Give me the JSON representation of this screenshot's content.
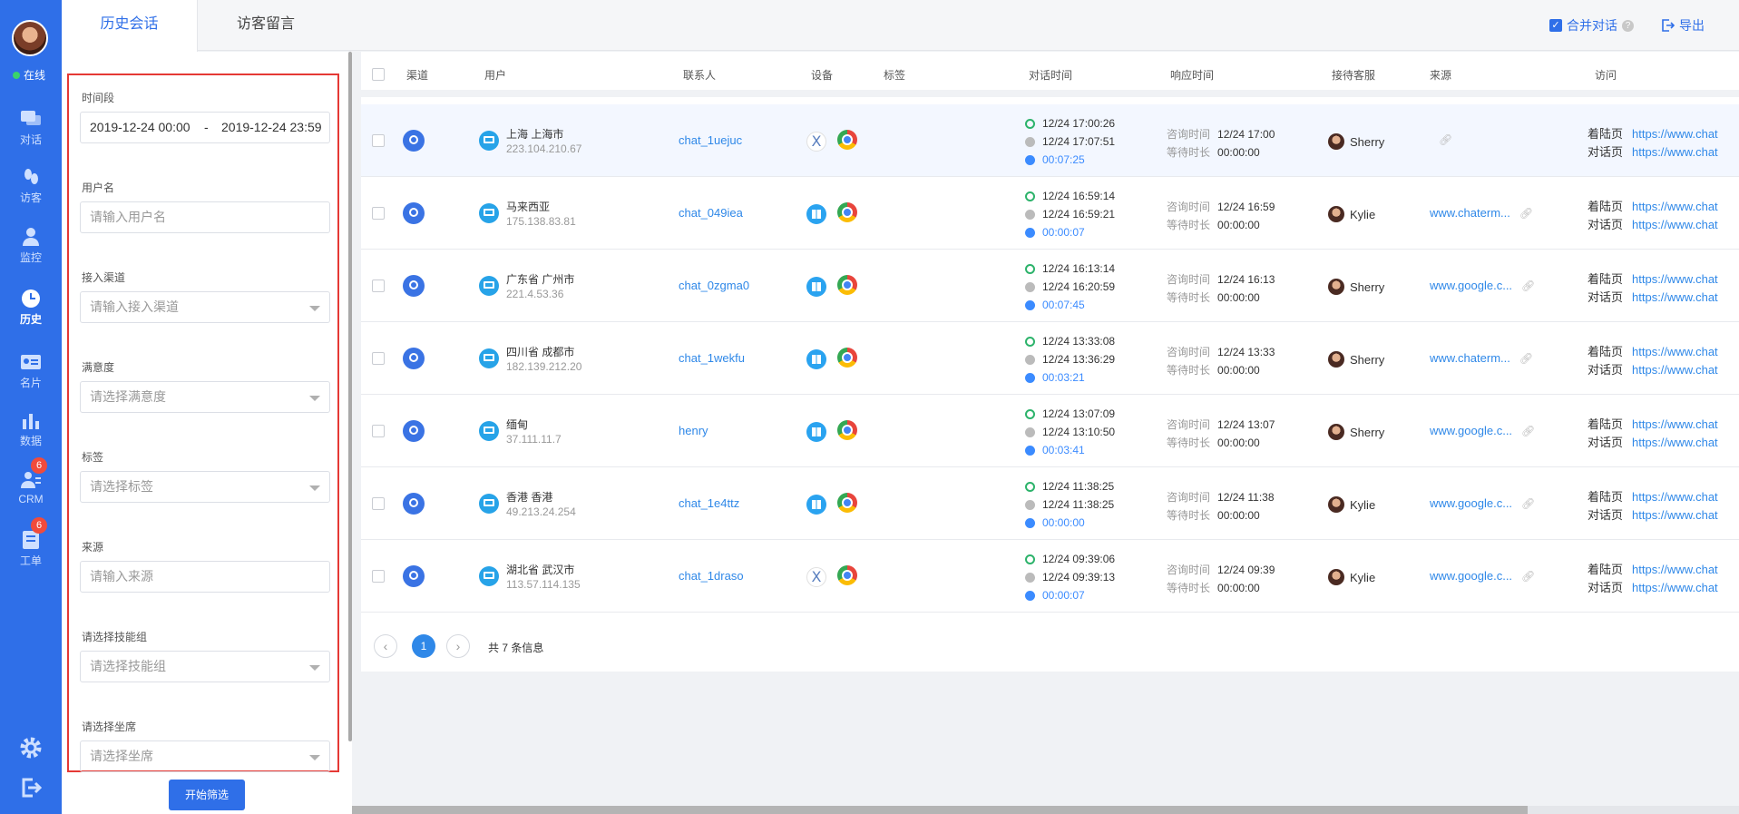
{
  "nav": {
    "status": "在线",
    "items": [
      {
        "label": "对话",
        "icon": "chat-icon"
      },
      {
        "label": "访客",
        "icon": "visitor-icon"
      },
      {
        "label": "监控",
        "icon": "monitor-icon"
      },
      {
        "label": "历史",
        "icon": "history-icon"
      },
      {
        "label": "名片",
        "icon": "card-icon"
      },
      {
        "label": "数据",
        "icon": "data-icon"
      },
      {
        "label": "CRM",
        "icon": "crm-icon",
        "badge": "6"
      },
      {
        "label": "工单",
        "icon": "ticket-icon",
        "badge": "6"
      }
    ]
  },
  "tabs": [
    "历史会话",
    "访客留言"
  ],
  "toolbar": {
    "merge_label": "合并对话",
    "help": "?",
    "export_label": "导出"
  },
  "filter": {
    "time_label": "时间段",
    "date_start": "2019-12-24 00:00",
    "date_sep": "-",
    "date_end": "2019-12-24 23:59",
    "username_label": "用户名",
    "username_placeholder": "请输入用户名",
    "channel_label": "接入渠道",
    "channel_placeholder": "请输入接入渠道",
    "satisfaction_label": "满意度",
    "satisfaction_placeholder": "请选择满意度",
    "tag_label": "标签",
    "tag_placeholder": "请选择标签",
    "source_label": "来源",
    "source_placeholder": "请输入来源",
    "skill_label": "请选择技能组",
    "skill_placeholder": "请选择技能组",
    "seat_label": "请选择坐席",
    "seat_placeholder": "请选择坐席",
    "submit_label": "开始筛选"
  },
  "table": {
    "headers": [
      "渠道",
      "用户",
      "联系人",
      "设备",
      "标签",
      "对话时间",
      "响应时间",
      "接待客服",
      "来源",
      "访问"
    ],
    "resp_labels": [
      "咨询时间",
      "等待时长"
    ],
    "visit_labels": [
      "着陆页",
      "对话页"
    ],
    "rows": [
      {
        "loc": "上海 上海市",
        "ip": "223.104.210.67",
        "contact": "chat_1uejuc",
        "os": "x",
        "start": "12/24 17:00:26",
        "end": "12/24 17:07:51",
        "dur": "00:07:25",
        "ask": "12/24 17:00",
        "wait": "00:00:00",
        "agent": "Sherry",
        "source": "",
        "landing": "https://www.chat",
        "chatpage": "https://www.chat"
      },
      {
        "loc": "马来西亚",
        "ip": "175.138.83.81",
        "contact": "chat_049iea",
        "os": "win",
        "start": "12/24 16:59:14",
        "end": "12/24 16:59:21",
        "dur": "00:00:07",
        "ask": "12/24 16:59",
        "wait": "00:00:00",
        "agent": "Kylie",
        "source": "www.chaterm...",
        "landing": "https://www.chat",
        "chatpage": "https://www.chat"
      },
      {
        "loc": "广东省 广州市",
        "ip": "221.4.53.36",
        "contact": "chat_0zgma0",
        "os": "win",
        "start": "12/24 16:13:14",
        "end": "12/24 16:20:59",
        "dur": "00:07:45",
        "ask": "12/24 16:13",
        "wait": "00:00:00",
        "agent": "Sherry",
        "source": "www.google.c...",
        "landing": "https://www.chat",
        "chatpage": "https://www.chat"
      },
      {
        "loc": "四川省 成都市",
        "ip": "182.139.212.20",
        "contact": "chat_1wekfu",
        "os": "win",
        "start": "12/24 13:33:08",
        "end": "12/24 13:36:29",
        "dur": "00:03:21",
        "ask": "12/24 13:33",
        "wait": "00:00:00",
        "agent": "Sherry",
        "source": "www.chaterm...",
        "landing": "https://www.chat",
        "chatpage": "https://www.chat"
      },
      {
        "loc": "缅甸",
        "ip": "37.111.11.7",
        "contact": "henry",
        "os": "win",
        "start": "12/24 13:07:09",
        "end": "12/24 13:10:50",
        "dur": "00:03:41",
        "ask": "12/24 13:07",
        "wait": "00:00:00",
        "agent": "Sherry",
        "source": "www.google.c...",
        "landing": "https://www.chat",
        "chatpage": "https://www.chat"
      },
      {
        "loc": "香港 香港",
        "ip": "49.213.24.254",
        "contact": "chat_1e4ttz",
        "os": "win",
        "start": "12/24 11:38:25",
        "end": "12/24 11:38:25",
        "dur": "00:00:00",
        "ask": "12/24 11:38",
        "wait": "00:00:00",
        "agent": "Kylie",
        "source": "www.google.c...",
        "landing": "https://www.chat",
        "chatpage": "https://www.chat"
      },
      {
        "loc": "湖北省 武汉市",
        "ip": "113.57.114.135",
        "contact": "chat_1draso",
        "os": "x",
        "start": "12/24 09:39:06",
        "end": "12/24 09:39:13",
        "dur": "00:00:07",
        "ask": "12/24 09:39",
        "wait": "00:00:00",
        "agent": "Kylie",
        "source": "www.google.c...",
        "landing": "https://www.chat",
        "chatpage": "https://www.chat"
      }
    ]
  },
  "pager": {
    "prev": "‹",
    "current": "1",
    "next": "›",
    "total": "共 7 条信息"
  }
}
